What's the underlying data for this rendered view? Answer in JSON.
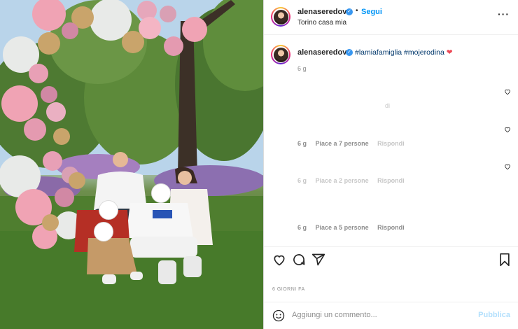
{
  "post": {
    "username": "alenaseredova",
    "follow_label": "Segui",
    "location": "Torino casa mia",
    "more_icon": "more-options-icon",
    "caption_hashtags": "#lamiafamiglia #mojerodina",
    "caption_emoji": "❤",
    "caption_age": "6 g"
  },
  "comments": [
    {
      "age": "6 g",
      "likes": "Piace a 7 persone",
      "reply": "Rispondi"
    },
    {
      "age": "6 g",
      "likes": "Piace a 2 persone",
      "reply": "Rispondi"
    },
    {
      "age": "6 g",
      "likes": "Piace a 5 persone",
      "reply": "Rispondi"
    }
  ],
  "faded_text": "di",
  "actions": {
    "like_icon": "heart-icon",
    "comment_icon": "comment-icon",
    "share_icon": "share-icon",
    "save_icon": "bookmark-icon"
  },
  "date_label": "6 GIORNI FA",
  "comment_box": {
    "placeholder": "Aggiungi un commento...",
    "publish_label": "Pubblica"
  },
  "colors": {
    "follow": "#0095f6",
    "hashtag": "#00376b",
    "heart": "#ed4956",
    "publish_disabled": "#b2dffc"
  }
}
